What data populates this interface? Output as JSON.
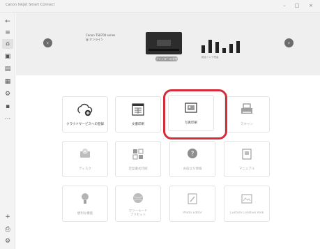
{
  "window": {
    "title": "Canon Inkjet Smart Connect",
    "minimize": "–",
    "maximize": "□",
    "close": "×"
  },
  "rail": {
    "back": "←",
    "menu": "≡",
    "home": "⌂",
    "photos": "▣",
    "documents": "▤",
    "scan": "▦",
    "settings": "⚙",
    "apps": "▪",
    "more": "···",
    "add": "+",
    "printer": "⎙",
    "gear": "⚙"
  },
  "banner": {
    "prev": "‹",
    "next": "›",
    "printer_name_line1": "Canon TS8700 series",
    "printer_name_line2": "@ オンライン",
    "printer_button": "プリンターの状態",
    "ink_label": "推定インク残量",
    "ink_levels": [
      0.45,
      0.8,
      0.65,
      0.3,
      0.55,
      0.7
    ],
    "ink_color": "#222222"
  },
  "tiles": {
    "cloud": {
      "label": "クラウドサービスへの登録"
    },
    "document": {
      "label": "文書印刷"
    },
    "photo": {
      "label": "写真印刷"
    },
    "scan": {
      "label": "スキャン"
    },
    "t5": {
      "label": "ディスク"
    },
    "t6": {
      "label": "定型書式印刷"
    },
    "t7": {
      "label": "お役立ち情報"
    },
    "t8": {
      "label": "マニュアル"
    },
    "t9": {
      "label": "便利な機能"
    },
    "t10": {
      "label": "カラーモード\nプリセット"
    },
    "t11": {
      "label": "Photo Editor"
    },
    "t12": {
      "label": "Custom Creative Park"
    }
  },
  "colors": {
    "highlight": "#d62b3a",
    "banner_bg": "#efefef",
    "rail_bg": "#f3f3f3"
  }
}
